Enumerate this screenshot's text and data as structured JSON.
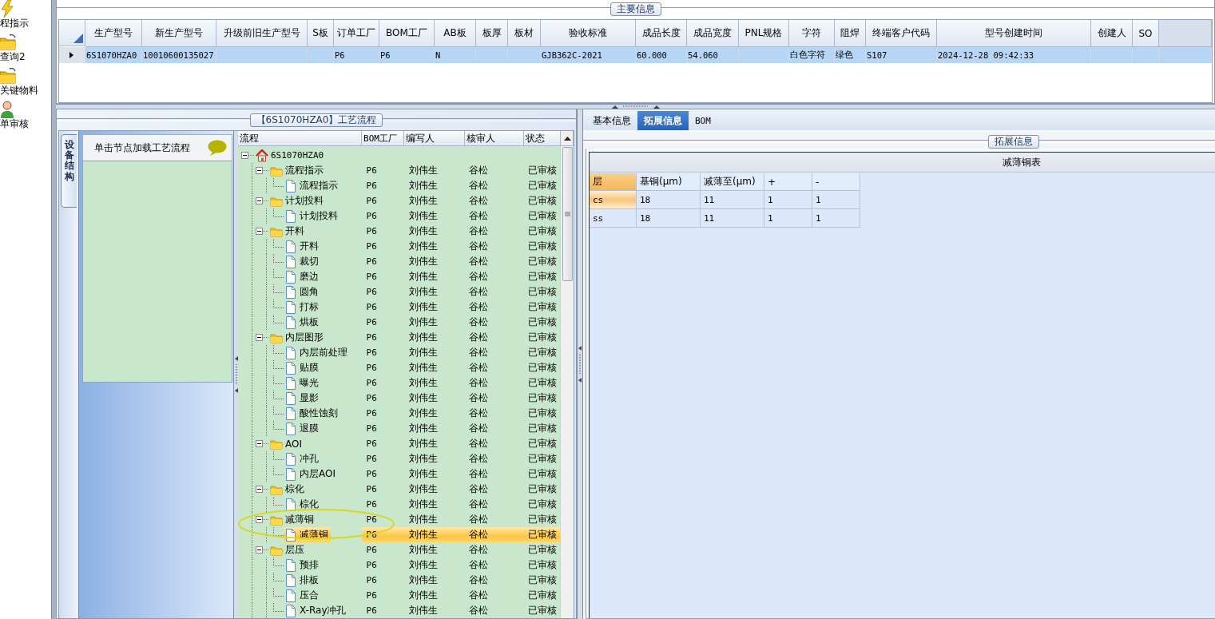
{
  "nav": [
    {
      "label": "程指示",
      "kind": "bolt"
    },
    {
      "label": "查询2",
      "kind": "folder"
    },
    {
      "label": "关键物料",
      "kind": "folder"
    },
    {
      "label": "单审核",
      "kind": "person"
    }
  ],
  "main_info": {
    "title": "主要信息",
    "columns": [
      "生产型号",
      "新生产型号",
      "升级前旧生产型号",
      "S板",
      "订单工厂",
      "BOM工厂",
      "AB板",
      "板厚",
      "板材",
      "验收标准",
      "成品长度",
      "成品宽度",
      "PNL规格",
      "字符",
      "阻焊",
      "终端客户代码",
      "型号创建时间",
      "创建人",
      "SO"
    ],
    "rows": [
      {
        "selected": true,
        "cells": [
          "6S1070HZA0",
          "10010600135027",
          null,
          null,
          "P6",
          "P6",
          "N",
          null,
          null,
          "GJB362C-2021",
          "60.000",
          "54.060",
          null,
          "白色字符",
          "绿色",
          "S107",
          "2024-12-28 09:42:33",
          null,
          null
        ]
      }
    ]
  },
  "process": {
    "title": "【6S1070HZA0】工艺流程",
    "side_tab": "设备结构",
    "hint": "单击节点加载工艺流程",
    "tree": {
      "columns": [
        "流程",
        "BOM工厂",
        "编写人",
        "核审人",
        "状态"
      ],
      "nodes": [
        {
          "kind": "root",
          "name": "6S1070HZA0",
          "expanded": true,
          "selected": false,
          "children": [
            {
              "kind": "folder",
              "name": "流程指示",
              "bom_factory": "P6",
              "writer": "刘伟生",
              "reviewer": "谷松",
              "status": "已审核",
              "expanded": true,
              "selected": false,
              "children": [
                {
                  "kind": "doc",
                  "name": "流程指示",
                  "bom_factory": "P6",
                  "writer": "刘伟生",
                  "reviewer": "谷松",
                  "status": "已审核",
                  "selected": false
                }
              ]
            },
            {
              "kind": "folder",
              "name": "计划投料",
              "bom_factory": "P6",
              "writer": "刘伟生",
              "reviewer": "谷松",
              "status": "已审核",
              "expanded": true,
              "selected": false,
              "children": [
                {
                  "kind": "doc",
                  "name": "计划投料",
                  "bom_factory": "P6",
                  "writer": "刘伟生",
                  "reviewer": "谷松",
                  "status": "已审核",
                  "selected": false
                }
              ]
            },
            {
              "kind": "folder",
              "name": "开料",
              "bom_factory": "P6",
              "writer": "刘伟生",
              "reviewer": "谷松",
              "status": "已审核",
              "expanded": true,
              "selected": false,
              "children": [
                {
                  "kind": "doc",
                  "name": "开料",
                  "bom_factory": "P6",
                  "writer": "刘伟生",
                  "reviewer": "谷松",
                  "status": "已审核",
                  "selected": false
                },
                {
                  "kind": "doc",
                  "name": "裁切",
                  "bom_factory": "P6",
                  "writer": "刘伟生",
                  "reviewer": "谷松",
                  "status": "已审核",
                  "selected": false
                },
                {
                  "kind": "doc",
                  "name": "磨边",
                  "bom_factory": "P6",
                  "writer": "刘伟生",
                  "reviewer": "谷松",
                  "status": "已审核",
                  "selected": false
                },
                {
                  "kind": "doc",
                  "name": "圆角",
                  "bom_factory": "P6",
                  "writer": "刘伟生",
                  "reviewer": "谷松",
                  "status": "已审核",
                  "selected": false
                },
                {
                  "kind": "doc",
                  "name": "打标",
                  "bom_factory": "P6",
                  "writer": "刘伟生",
                  "reviewer": "谷松",
                  "status": "已审核",
                  "selected": false
                },
                {
                  "kind": "doc",
                  "name": "烘板",
                  "bom_factory": "P6",
                  "writer": "刘伟生",
                  "reviewer": "谷松",
                  "status": "已审核",
                  "selected": false
                }
              ]
            },
            {
              "kind": "folder",
              "name": "内层图形",
              "bom_factory": "P6",
              "writer": "刘伟生",
              "reviewer": "谷松",
              "status": "已审核",
              "expanded": true,
              "selected": false,
              "children": [
                {
                  "kind": "doc",
                  "name": "内层前处理",
                  "bom_factory": "P6",
                  "writer": "刘伟生",
                  "reviewer": "谷松",
                  "status": "已审核",
                  "selected": false
                },
                {
                  "kind": "doc",
                  "name": "贴膜",
                  "bom_factory": "P6",
                  "writer": "刘伟生",
                  "reviewer": "谷松",
                  "status": "已审核",
                  "selected": false
                },
                {
                  "kind": "doc",
                  "name": "曝光",
                  "bom_factory": "P6",
                  "writer": "刘伟生",
                  "reviewer": "谷松",
                  "status": "已审核",
                  "selected": false
                },
                {
                  "kind": "doc",
                  "name": "显影",
                  "bom_factory": "P6",
                  "writer": "刘伟生",
                  "reviewer": "谷松",
                  "status": "已审核",
                  "selected": false
                },
                {
                  "kind": "doc",
                  "name": "酸性蚀刻",
                  "bom_factory": "P6",
                  "writer": "刘伟生",
                  "reviewer": "谷松",
                  "status": "已审核",
                  "selected": false
                },
                {
                  "kind": "doc",
                  "name": "退膜",
                  "bom_factory": "P6",
                  "writer": "刘伟生",
                  "reviewer": "谷松",
                  "status": "已审核",
                  "selected": false
                }
              ]
            },
            {
              "kind": "folder",
              "name": "AOI",
              "bom_factory": "P6",
              "writer": "刘伟生",
              "reviewer": "谷松",
              "status": "已审核",
              "expanded": true,
              "selected": false,
              "children": [
                {
                  "kind": "doc",
                  "name": "冲孔",
                  "bom_factory": "P6",
                  "writer": "刘伟生",
                  "reviewer": "谷松",
                  "status": "已审核",
                  "selected": false
                },
                {
                  "kind": "doc",
                  "name": "内层AOI",
                  "bom_factory": "P6",
                  "writer": "刘伟生",
                  "reviewer": "谷松",
                  "status": "已审核",
                  "selected": false
                }
              ]
            },
            {
              "kind": "folder",
              "name": "棕化",
              "bom_factory": "P6",
              "writer": "刘伟生",
              "reviewer": "谷松",
              "status": "已审核",
              "expanded": true,
              "selected": false,
              "children": [
                {
                  "kind": "doc",
                  "name": "棕化",
                  "bom_factory": "P6",
                  "writer": "刘伟生",
                  "reviewer": "谷松",
                  "status": "已审核",
                  "selected": false
                }
              ]
            },
            {
              "kind": "folder",
              "name": "减薄铜",
              "bom_factory": "P6",
              "writer": "刘伟生",
              "reviewer": "谷松",
              "status": "已审核",
              "expanded": true,
              "selected": false,
              "children": [
                {
                  "kind": "doc",
                  "name": "减薄铜",
                  "bom_factory": "P6",
                  "writer": "刘伟生",
                  "reviewer": "谷松",
                  "status": "已审核",
                  "selected": true
                }
              ]
            },
            {
              "kind": "folder",
              "name": "层压",
              "bom_factory": "P6",
              "writer": "刘伟生",
              "reviewer": "谷松",
              "status": "已审核",
              "expanded": true,
              "selected": false,
              "children": [
                {
                  "kind": "doc",
                  "name": "预排",
                  "bom_factory": "P6",
                  "writer": "刘伟生",
                  "reviewer": "谷松",
                  "status": "已审核",
                  "selected": false
                },
                {
                  "kind": "doc",
                  "name": "排板",
                  "bom_factory": "P6",
                  "writer": "刘伟生",
                  "reviewer": "谷松",
                  "status": "已审核",
                  "selected": false
                },
                {
                  "kind": "doc",
                  "name": "压合",
                  "bom_factory": "P6",
                  "writer": "刘伟生",
                  "reviewer": "谷松",
                  "status": "已审核",
                  "selected": false
                },
                {
                  "kind": "doc",
                  "name": "X-Ray冲孔",
                  "bom_factory": "P6",
                  "writer": "刘伟生",
                  "reviewer": "谷松",
                  "status": "已审核",
                  "selected": false
                }
              ]
            }
          ]
        }
      ]
    }
  },
  "details": {
    "tabs": [
      {
        "label": "基本信息",
        "selected": false
      },
      {
        "label": "拓展信息",
        "selected": true
      },
      {
        "label": "BOM",
        "selected": false
      }
    ],
    "group_title": "拓展信息",
    "table": {
      "title": "减薄铜表",
      "columns": [
        {
          "label": "层",
          "highlighted": true
        },
        {
          "label": "基铜(μm)",
          "highlighted": false
        },
        {
          "label": "减薄至(μm)",
          "highlighted": false
        },
        {
          "label": "+",
          "highlighted": false
        },
        {
          "label": "-",
          "highlighted": false
        }
      ],
      "rows": [
        {
          "selected": true,
          "cells": [
            "cs",
            "18",
            "11",
            "1",
            "1"
          ]
        },
        {
          "selected": false,
          "cells": [
            "ss",
            "18",
            "11",
            "1",
            "1"
          ]
        }
      ]
    }
  }
}
